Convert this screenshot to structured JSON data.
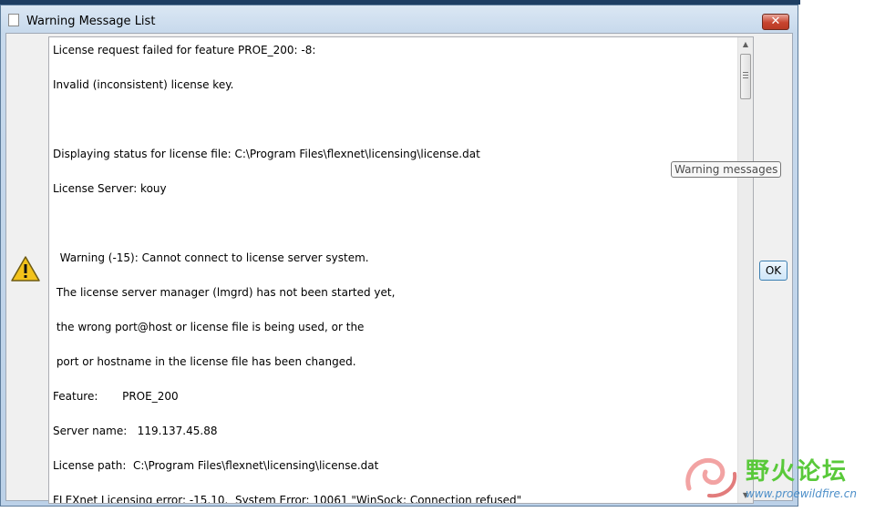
{
  "window": {
    "title": "Warning Message List",
    "close_label": "✕"
  },
  "message_lines": [
    "License request failed for feature PROE_200: -8:",
    "",
    "Invalid (inconsistent) license key.",
    "",
    "",
    "",
    "Displaying status for license file: C:\\Program Files\\flexnet\\licensing\\license.dat",
    "",
    "License Server: kouy",
    "",
    "",
    "",
    "  Warning (-15): Cannot connect to license server system.",
    "",
    " The license server manager (lmgrd) has not been started yet,",
    "",
    " the wrong port@host or license file is being used, or the",
    "",
    " port or hostname in the license file has been changed.",
    "",
    "Feature:       PROE_200",
    "",
    "Server name:   119.137.45.88",
    "",
    "License path:  C:\\Program Files\\flexnet\\licensing\\license.dat",
    "",
    "FLEXnet Licensing error: -15,10.  System Error: 10061 \"WinSock: Connection refused\""
  ],
  "tooltip": "Warning messages",
  "buttons": {
    "ok_label": "OK"
  },
  "icons": {
    "warning": "warning-icon",
    "close": "close-icon",
    "window": "window-icon"
  },
  "watermark": {
    "text": "野火论坛",
    "url": "www.proewildfire.cn"
  }
}
